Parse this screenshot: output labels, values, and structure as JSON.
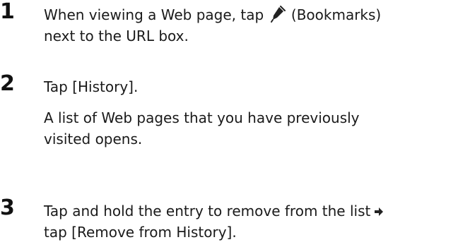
{
  "steps": [
    {
      "number": "1",
      "line1_before": "When viewing a Web page, tap ",
      "icon": "bookmarks-icon",
      "line1_after": " (Bookmarks)",
      "line2": "next to the URL box."
    },
    {
      "number": "2",
      "line1": "Tap [History].",
      "sub_line1": "A list of Web pages that you have previously",
      "sub_line2": "visited opens."
    },
    {
      "number": "3",
      "line1": "Tap and hold the entry to remove from the list",
      "arrow_icon": "arrow-right-icon",
      "line2": "tap [Remove from History]."
    }
  ]
}
